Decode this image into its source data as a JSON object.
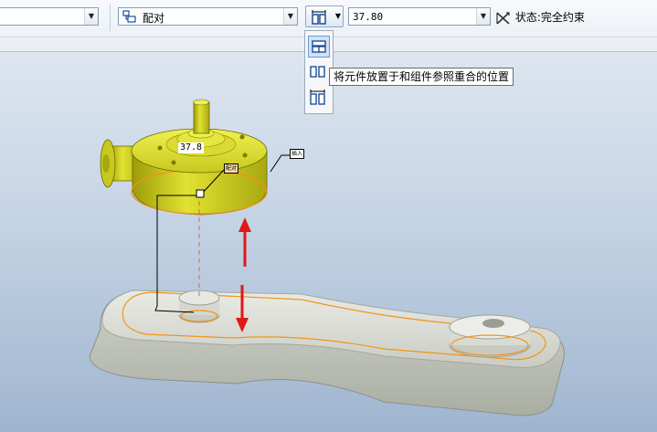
{
  "toolbar": {
    "left_combo_value": "",
    "constraint_type": "配对",
    "offset_value": "37.80",
    "status_label": "状态:完全约束"
  },
  "dropdown": {
    "items": [
      {
        "icon": "coincident-icon",
        "selected": true
      },
      {
        "icon": "oriented-icon",
        "selected": false
      },
      {
        "icon": "offset-icon",
        "selected": false
      }
    ]
  },
  "tooltip": {
    "text": "将元件放置于和组件参照重合的位置"
  },
  "viewport": {
    "offset_label": "37.8",
    "mate_label": "配对",
    "insert_label": "插入"
  },
  "colors": {
    "part_yellow": "#d8d81a",
    "base_gray": "#d4d6cf",
    "highlight_orange": "#f2941a",
    "arrow_red": "#e01818"
  }
}
